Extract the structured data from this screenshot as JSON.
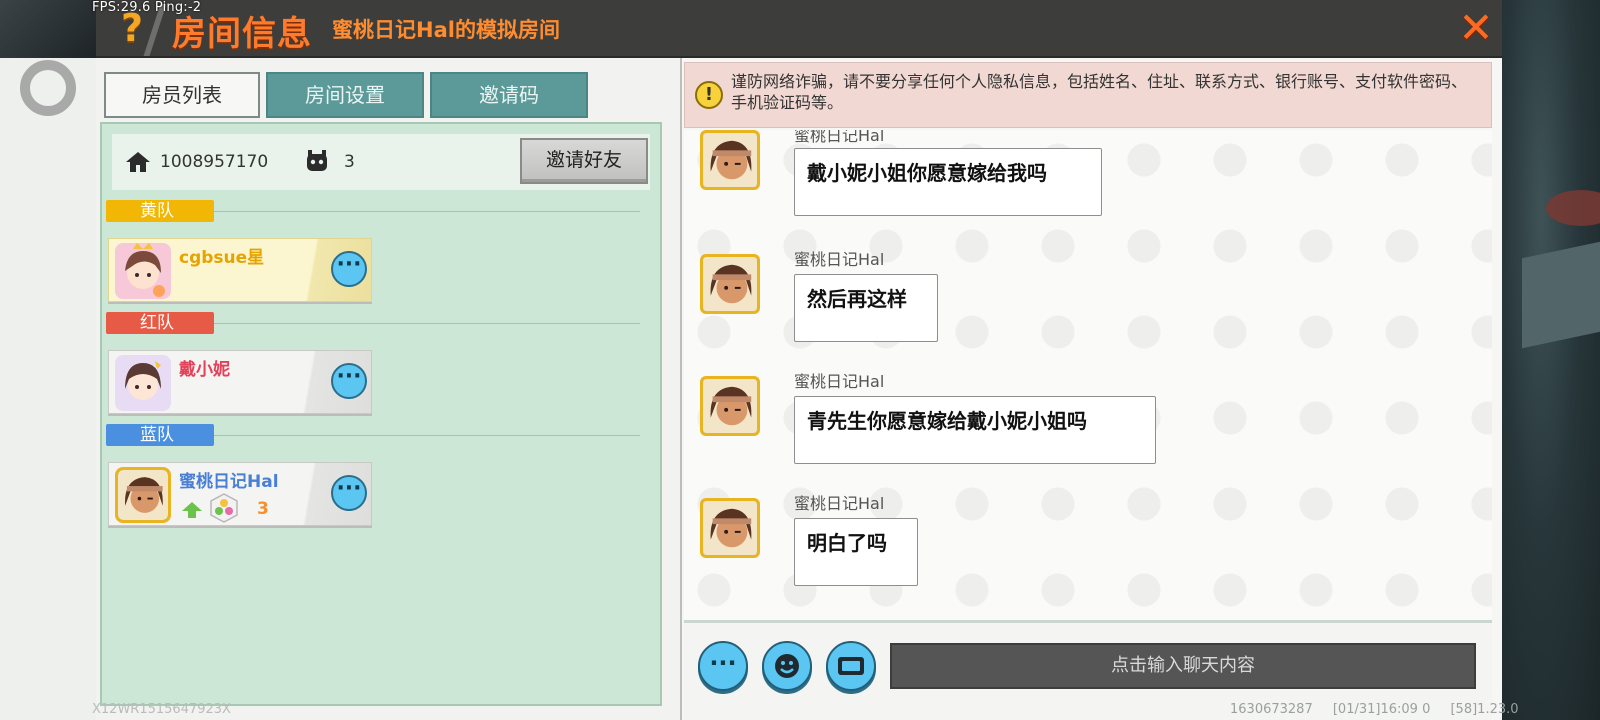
{
  "hud": {
    "fps": "FPS:29.6  Ping:-2",
    "device_id": "X12WR1515647923X",
    "footer_left": "1630673287",
    "footer_mid": "[01/31]16:09 0",
    "footer_right": "[58]1.23.0"
  },
  "header": {
    "help_symbol": "?",
    "title": "房间信息",
    "subtitle": "蜜桃日记Hal的模拟房间",
    "close_symbol": "✕"
  },
  "tabs": [
    {
      "label": "房员列表",
      "active": true
    },
    {
      "label": "房间设置",
      "active": false
    },
    {
      "label": "邀请码",
      "active": false
    }
  ],
  "room": {
    "id": "1008957170",
    "player_count": "3",
    "invite_button": "邀请好友"
  },
  "teams": [
    {
      "label": "黄队",
      "color": "#f2b705",
      "member": {
        "name": "cgbsue星",
        "name_color": "#e6a400"
      }
    },
    {
      "label": "红队",
      "color": "#e65a46",
      "member": {
        "name": "戴小妮",
        "name_color": "#e3405a"
      }
    },
    {
      "label": "蓝队",
      "color": "#4a8fe0",
      "member": {
        "name": "蜜桃日记Hal",
        "name_color": "#4a7fd6",
        "level": "3"
      }
    }
  ],
  "more_symbol": "···",
  "chat": {
    "warning": "谨防网络诈骗，请不要分享任何个人隐私信息，包括姓名、住址、联系方式、银行账号、支付软件密码、手机验证码等。",
    "warning_icon": "!",
    "messages": [
      {
        "name": "蜜桃日记Hal",
        "text": "戴小妮小姐你愿意嫁给我吗"
      },
      {
        "name": "蜜桃日记Hal",
        "text": "然后再这样"
      },
      {
        "name": "蜜桃日记Hal",
        "text": "青先生你愿意嫁给戴小妮小姐吗"
      },
      {
        "name": "蜜桃日记Hal",
        "text": "明白了吗"
      }
    ],
    "input_placeholder": "点击输入聊天内容",
    "buttons": {
      "more": "···",
      "emoji": "emoji-icon",
      "keyboard": "keyboard-icon"
    }
  },
  "colors": {
    "accent_orange": "#ff7a2a",
    "tab_teal": "#5b9a98",
    "member_panel": "#cde7d6",
    "round_button": "#5bc6f2"
  }
}
